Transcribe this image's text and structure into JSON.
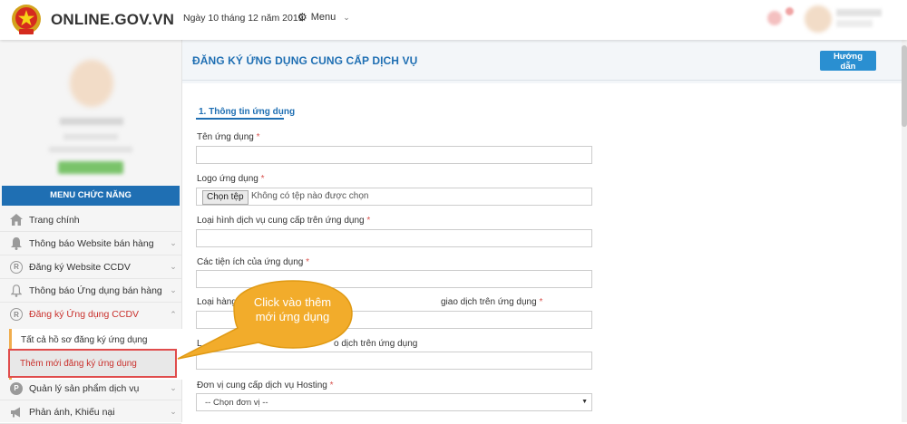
{
  "header": {
    "brand": "ONLINE.GOV.VN",
    "date": "Ngày 10 tháng 12 năm 2019",
    "menu_label": "Menu"
  },
  "sidebar": {
    "menu_heading": "MENU CHỨC NĂNG",
    "items": [
      {
        "label": "Trang chính",
        "icon": "home-icon"
      },
      {
        "label": "Thông báo Website bán hàng",
        "icon": "bell-icon"
      },
      {
        "label": "Đăng ký Website CCDV",
        "icon": "registered-icon"
      },
      {
        "label": "Thông báo Ứng dụng bán hàng",
        "icon": "bell-outline-icon"
      },
      {
        "label": "Đăng ký Ứng dụng CCDV",
        "icon": "registered-icon"
      },
      {
        "label": "Quản lý sản phẩm dịch vụ",
        "icon": "parking-icon"
      },
      {
        "label": "Phản ánh, Khiếu nại",
        "icon": "megaphone-icon"
      }
    ],
    "submenu": [
      {
        "label": "Tất cả hồ sơ đăng ký ứng dụng"
      },
      {
        "label": "Thêm mới đăng ký ứng dụng"
      }
    ]
  },
  "main": {
    "page_title": "ĐĂNG KÝ ỨNG DỤNG CUNG CẤP DỊCH VỤ",
    "help_button": "Hướng dẫn",
    "section_title": "1. Thông tin ứng dụng",
    "fields": [
      {
        "label": "Tên ứng dụng",
        "required": "*"
      },
      {
        "label": "Logo ứng dụng",
        "required": "*",
        "file_button": "Chọn tệp",
        "file_status": "Không có tệp nào được chọn"
      },
      {
        "label": "Loại hình dịch vụ cung cấp trên ứng dụng",
        "required": "*"
      },
      {
        "label": "Các tiện ích của ứng dụng",
        "required": "*"
      },
      {
        "label": "Loại hàng",
        "label_tail": "giao dịch trên ứng dụng",
        "required": "*"
      },
      {
        "label": "L",
        "label_tail": "o dịch trên ứng dụng",
        "required": ""
      },
      {
        "label": "Đơn vị cung cấp dịch vụ Hosting",
        "required": "*",
        "placeholder": "-- Chọn đơn vị --"
      }
    ]
  },
  "callout": {
    "text": "Click vào thêm mới ứng dụng",
    "fill": "#f2ac2b"
  }
}
